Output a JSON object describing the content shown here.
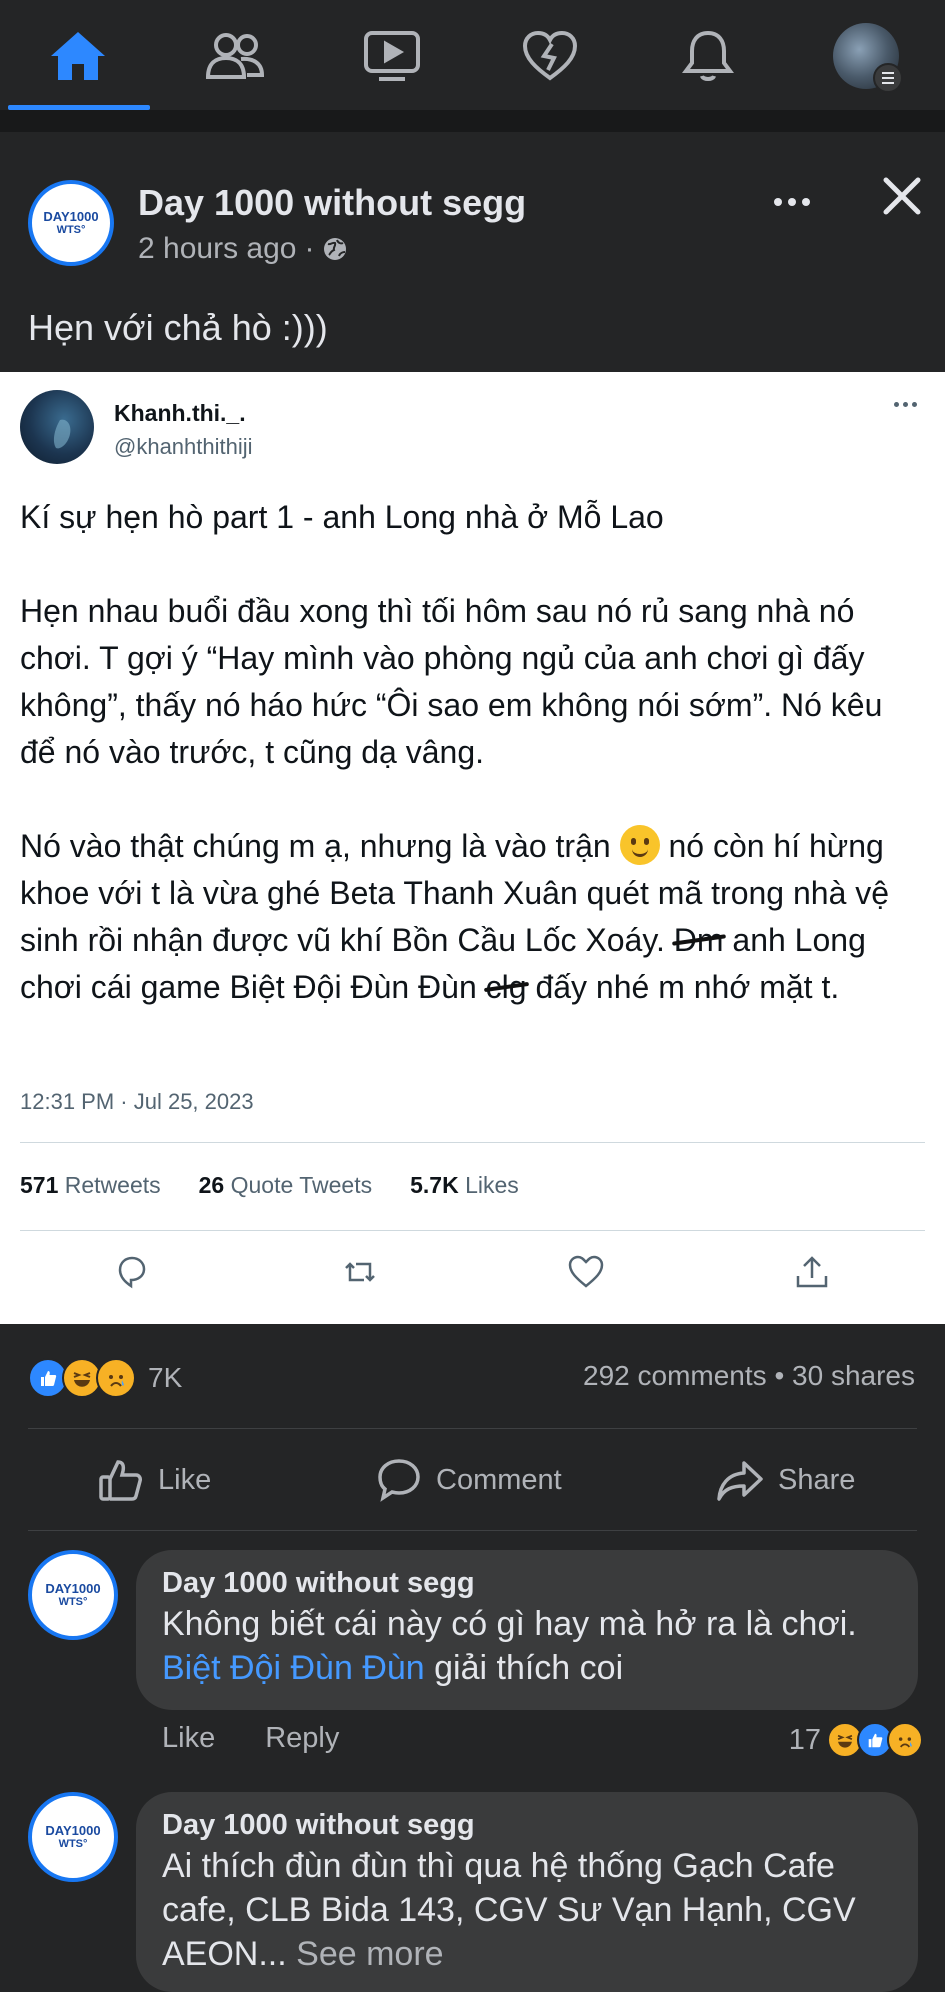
{
  "nav": {
    "items": [
      "home-icon",
      "friends-icon",
      "watch-icon",
      "dating-icon",
      "notifications-icon",
      "profile-avatar"
    ],
    "active_color": "#2d88ff"
  },
  "post": {
    "author": "Day 1000 without segg",
    "avatar_text_1": "DAY1000",
    "avatar_text_2": "WTS°",
    "time": "2 hours ago",
    "separator": "·",
    "caption": "Hẹn với chả hò :)))"
  },
  "tweet": {
    "name": "Khanh.thi._.",
    "handle": "@khanhthithiji",
    "para1": "Kí sự hẹn hò part 1 - anh Long nhà ở Mỗ Lao",
    "para2": "Hẹn nhau buổi đầu xong thì tối hôm sau nó rủ sang nhà nó chơi. T gợi ý “Hay mình vào phòng ngủ của anh chơi gì đấy không”, thấy nó háo hức “Ôi sao em không nói sớm”. Nó kêu để nó vào trước, t cũng dạ vâng.",
    "para3_a": "Nó vào thật chúng m ạ, nhưng là vào trận",
    "para3_b": "nó còn hí hừng khoe với t là vừa ghé Beta Thanh Xuân quét mã trong nhà vệ sinh rồi nhận được vũ khí Bồn Cầu Lốc Xoáy.",
    "para3_scribble1": "Dm",
    "para3_c": "anh Long chơi cái game Biệt Đội Đùn Đùn",
    "para3_scribble2": "clg",
    "para3_d": "đấy nhé m nhớ mặt t.",
    "timestamp": "12:31 PM · Jul 25, 2023",
    "retweets_count": "571",
    "retweets_label": "Retweets",
    "quotes_count": "26",
    "quotes_label": "Quote Tweets",
    "likes_count": "5.7K",
    "likes_label": "Likes"
  },
  "reactions": {
    "count": "7K",
    "comments": "292 comments",
    "dot": "•",
    "shares": "30 shares"
  },
  "actions": {
    "like": "Like",
    "comment": "Comment",
    "share": "Share"
  },
  "comments": [
    {
      "author": "Day 1000 without segg",
      "text_a": "Không biết cái này có gì hay mà hở ra là chơi. ",
      "link": "Biệt Đội Đùn Đùn",
      "text_b": " giải thích coi",
      "like": "Like",
      "reply": "Reply",
      "react_count": "17"
    },
    {
      "author": "Day 1000 without segg",
      "text_a": "Ai thích đùn đùn thì qua hệ thống Gạch Cafe cafe, CLB Bida 143, CGV Sư Vạn Hạnh, CGV AEON...",
      "see_more": "See more"
    }
  ]
}
